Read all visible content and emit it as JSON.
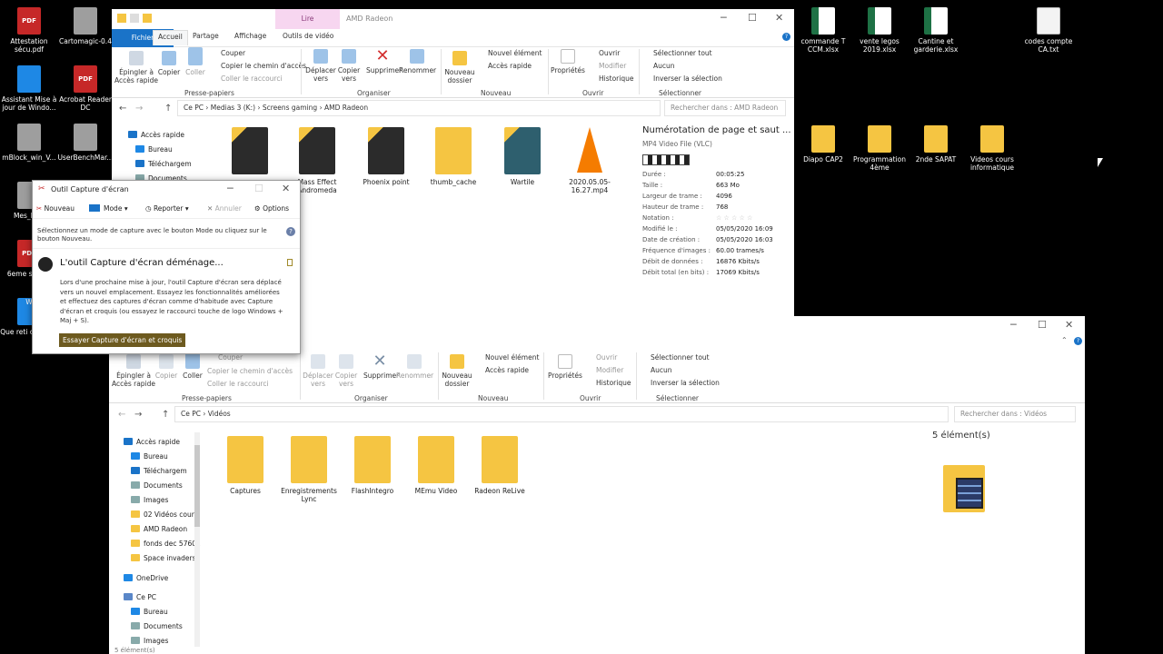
{
  "desktop": {
    "left_icons": [
      {
        "label": "Attestation sécu.pdf",
        "icon": "pdf-icon",
        "glyph": "PDF"
      },
      {
        "label": "Cartomagic-0.4",
        "icon": "app-icon",
        "glyph": ""
      },
      {
        "label": "Assistant Mise à jour de Windo...",
        "icon": "windows-icon",
        "glyph": ""
      },
      {
        "label": "Acrobat Reader DC",
        "icon": "pdf-icon",
        "glyph": "PDF"
      },
      {
        "label": "mBlock_win_V...",
        "icon": "panda-icon",
        "glyph": ""
      },
      {
        "label": "UserBenchMar...",
        "icon": "app-icon",
        "glyph": ""
      },
      {
        "label": "Mes_Driv",
        "icon": "app-icon",
        "glyph": ""
      },
      {
        "label": "6eme se MS.",
        "icon": "pdf-icon",
        "glyph": "PDF"
      },
      {
        "label": "Que reti cette pe",
        "icon": "word-icon",
        "glyph": "W"
      }
    ],
    "right_icons": [
      {
        "label": "commande T CCM.xlsx",
        "icon": "excel-icon"
      },
      {
        "label": "vente legos 2019.xlsx",
        "icon": "excel-icon"
      },
      {
        "label": "Cantine et garderie.xlsx",
        "icon": "excel-icon"
      },
      {
        "label": "codes compte CA.txt",
        "icon": "text-file-icon"
      },
      {
        "label": "Diapo CAP2",
        "icon": "folder-icon"
      },
      {
        "label": "Programmation 4ème",
        "icon": "folder-icon"
      },
      {
        "label": "2nde SAPAT",
        "icon": "folder-icon"
      },
      {
        "label": "Videos cours informatique",
        "icon": "folder-icon"
      }
    ]
  },
  "explorer_top": {
    "context_tab": "Lire",
    "title": "AMD Radeon",
    "tabs": [
      "Fichier",
      "Accueil",
      "Partage",
      "Affichage",
      "Outils de vidéo"
    ],
    "ribbon": {
      "pin": "Épingler à Accès rapide",
      "copy": "Copier",
      "paste": "Coller",
      "cut": "Couper",
      "copy_path": "Copier le chemin d'accès",
      "paste_shortcut": "Coller le raccourci",
      "group_clipboard": "Presse-papiers",
      "move": "Déplacer vers",
      "copy_to": "Copier vers",
      "delete": "Supprimer",
      "rename": "Renommer",
      "group_organize": "Organiser",
      "new_folder": "Nouveau dossier",
      "new_item": "Nouvel élément",
      "easy_access": "Accès rapide",
      "group_new": "Nouveau",
      "properties": "Propriétés",
      "open": "Ouvrir",
      "edit": "Modifier",
      "history": "Historique",
      "group_open": "Ouvrir",
      "select_all": "Sélectionner tout",
      "select_none": "Aucun",
      "invert": "Inverser la sélection",
      "group_select": "Sélectionner"
    },
    "breadcrumb": [
      "Ce PC",
      "Medias 3 (K:)",
      "Screens gaming",
      "AMD Radeon"
    ],
    "search_placeholder": "Rechercher dans : AMD Radeon",
    "nav": [
      {
        "label": "Accès rapide",
        "icon": "star-icon"
      },
      {
        "label": "Bureau",
        "icon": "desktop-icon"
      },
      {
        "label": "Téléchargem",
        "icon": "download-icon"
      },
      {
        "label": "Documents",
        "icon": "documents-icon"
      }
    ],
    "files": [
      {
        "name": "",
        "thumb": "dark"
      },
      {
        "name": "Mass Effect Andromeda",
        "thumb": "dark"
      },
      {
        "name": "Phoenix point",
        "thumb": "dark"
      },
      {
        "name": "thumb_cache",
        "thumb": "fold"
      },
      {
        "name": "Wartile",
        "thumb": "teal"
      },
      {
        "name": "2020.05.05-16.27.mp4",
        "thumb": "vlc"
      }
    ],
    "details": {
      "title": "Numérotation de page et saut ...",
      "type": "MP4 Video File (VLC)",
      "rows": [
        {
          "k": "Durée :",
          "v": "00:05:25"
        },
        {
          "k": "Taille :",
          "v": "663 Mo"
        },
        {
          "k": "Largeur de trame :",
          "v": "4096"
        },
        {
          "k": "Hauteur de trame :",
          "v": "768"
        },
        {
          "k": "Notation :",
          "v": "☆ ☆ ☆ ☆ ☆"
        },
        {
          "k": "Modifié le :",
          "v": "05/05/2020 16:09"
        },
        {
          "k": "Date de création :",
          "v": "05/05/2020 16:03"
        },
        {
          "k": "Fréquence d'images :",
          "v": "60.00 trames/s"
        },
        {
          "k": "Débit de données :",
          "v": "16876 Kbits/s"
        },
        {
          "k": "Débit total (en bits) :",
          "v": "17069 Kbits/s"
        }
      ]
    }
  },
  "explorer_bottom": {
    "ribbon": {
      "cut": "Couper",
      "pin": "Épingler à Accès rapide",
      "copy": "Copier",
      "paste": "Coller",
      "copy_path": "Copier le chemin d'accès",
      "paste_shortcut": "Coller le raccourci",
      "group_clipboard": "Presse-papiers",
      "move": "Déplacer vers",
      "copy_to": "Copier vers",
      "delete": "Supprimer",
      "rename": "Renommer",
      "group_organize": "Organiser",
      "new_folder": "Nouveau dossier",
      "new_item": "Nouvel élément",
      "easy_access": "Accès rapide",
      "group_new": "Nouveau",
      "properties": "Propriétés",
      "open": "Ouvrir",
      "edit": "Modifier",
      "history": "Historique",
      "group_open": "Ouvrir",
      "select_all": "Sélectionner tout",
      "select_none": "Aucun",
      "invert": "Inverser la sélection",
      "group_select": "Sélectionner"
    },
    "breadcrumb": [
      "Ce PC",
      "Vidéos"
    ],
    "search_placeholder": "Rechercher dans : Vidéos",
    "nav": [
      {
        "label": "Accès rapide",
        "icon": "star-icon"
      },
      {
        "label": "Bureau",
        "icon": "desktop-icon"
      },
      {
        "label": "Téléchargem",
        "icon": "download-icon"
      },
      {
        "label": "Documents",
        "icon": "documents-icon"
      },
      {
        "label": "Images",
        "icon": "images-icon"
      },
      {
        "label": "02 Vidéos cours",
        "icon": "folder-icon"
      },
      {
        "label": "AMD Radeon",
        "icon": "folder-icon"
      },
      {
        "label": "fonds dec 5760x",
        "icon": "folder-icon"
      },
      {
        "label": "Space invaders",
        "icon": "folder-icon"
      },
      {
        "label": "OneDrive",
        "icon": "cloud-icon"
      },
      {
        "label": "Ce PC",
        "icon": "pc-icon"
      },
      {
        "label": "Bureau",
        "icon": "desktop-icon"
      },
      {
        "label": "Documents",
        "icon": "documents-icon"
      },
      {
        "label": "Images",
        "icon": "images-icon"
      }
    ],
    "files": [
      {
        "name": "Captures"
      },
      {
        "name": "Enregistrements Lync"
      },
      {
        "name": "FlashIntegro"
      },
      {
        "name": "MEmu Video"
      },
      {
        "name": "Radeon ReLive"
      }
    ],
    "count": "5 élément(s)",
    "status": "5 élément(s)"
  },
  "snip": {
    "title": "Outil Capture d'écran",
    "toolbar": [
      "Nouveau",
      "Mode",
      "Reporter",
      "Annuler",
      "Options"
    ],
    "hint": "Sélectionnez un mode de capture avec le bouton Mode ou cliquez sur le bouton Nouveau.",
    "heading": "L'outil Capture d'écran déménage...",
    "body": "Lors d'une prochaine mise à jour, l'outil Capture d'écran sera déplacé vers un nouvel emplacement. Essayez les fonctionnalités améliorées et effectuez des captures d'écran comme d'habitude avec Capture d'écran et croquis (ou essayez le raccourci touche de logo Windows + Maj + S).",
    "cta": "Essayer Capture d'écran et croquis"
  },
  "colors": {
    "accent": "#1a73c8",
    "context_tab": "#f7d6f0",
    "cta": "#6d5a1f",
    "folder": "#f5c542"
  }
}
